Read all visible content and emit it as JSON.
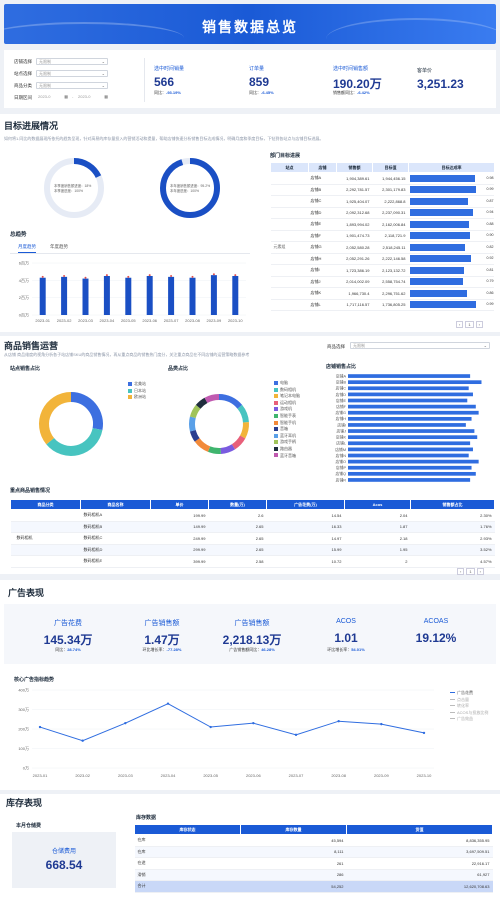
{
  "header": {
    "title": "销售数据总览"
  },
  "filters": [
    {
      "label": "店铺选择",
      "value": "无限制"
    },
    {
      "label": "站点选择",
      "value": "无限制"
    },
    {
      "label": "商品分类",
      "value": "无限制"
    },
    {
      "label": "日期区间",
      "start": "2023-0",
      "end": "2023-0"
    }
  ],
  "kpis": [
    {
      "label": "选中时间销量",
      "value": "566",
      "sub_label": "同比：",
      "sub_value": "-93.19%"
    },
    {
      "label": "订单量",
      "value": "859",
      "sub_label": "同比：",
      "sub_value": "-6.45%"
    },
    {
      "label": "选中时间销售额",
      "value": "190.20万",
      "sub_label": "销售额同比：",
      "sub_value": "-6.42%"
    },
    {
      "label": "客单价",
      "value": "3,251.23",
      "sub_label": "",
      "sub_value": ""
    }
  ],
  "target": {
    "title": "目标进展情况",
    "desc": "如何将1.同比的数据展现所依托的趋势呈现，针对高昂的库存量投入的营销活动和提量，帮助店铺快速分析销售目标达成情况，明确月度和季度目标，下钻到各站点与店铺目标进展。",
    "gauge1": {
      "line1": "本季度销售额进度：",
      "value1": "18%",
      "line2": "本季度进度：",
      "value2": "100%",
      "fraction": 0.18
    },
    "gauge2": {
      "line1": "本年度销售额进度：",
      "value1": "95.2%",
      "line2": "本年度进度：",
      "value2": "100%",
      "fraction": 0.952
    },
    "trend_title": "总趋势",
    "tabs": [
      "月度趋势",
      "年度趋势"
    ],
    "dept_title": "部门目标进展",
    "dept_headers": [
      "站点",
      "店铺",
      "销售额",
      "目标值",
      "目标达成率"
    ],
    "dept_group": "元素组",
    "dept_rows": [
      {
        "store": "店铺A",
        "sales": "1,904,389.61",
        "target": "1,944,456.15",
        "rate": 0.98
      },
      {
        "store": "店铺B",
        "sales": "2,292,781.57",
        "target": "2,301,179.83",
        "rate": 0.99
      },
      {
        "store": "店铺C",
        "sales": "1,925,404.07",
        "target": "2,222,868.8",
        "rate": 0.87
      },
      {
        "store": "店铺D",
        "sales": "2,092,312.68",
        "target": "2,237,090.31",
        "rate": 0.94
      },
      {
        "store": "店铺E",
        "sales": "1,893,994.02",
        "target": "2,162,006.84",
        "rate": 0.88
      },
      {
        "store": "店铺F",
        "sales": "1,901,474.73",
        "target": "2,118,721.9",
        "rate": 0.9
      },
      {
        "store": "店铺G",
        "sales": "2,052,580.28",
        "target": "2,518,245.11",
        "rate": 0.82
      },
      {
        "store": "店铺H",
        "sales": "2,052,291.26",
        "target": "2,222,146.58",
        "rate": 0.92
      },
      {
        "store": "店铺I",
        "sales": "1,723,386.19",
        "target": "2,123,132.72",
        "rate": 0.81
      },
      {
        "store": "店铺J",
        "sales": "2,014,002.09",
        "target": "2,558,754.74",
        "rate": 0.79
      },
      {
        "store": "店铺K",
        "sales": "1,966,730.4",
        "target": "2,296,751.62",
        "rate": 0.86
      },
      {
        "store": "店铺L",
        "sales": "1,717,116.57",
        "target": "1,736,805.25",
        "rate": 0.99
      }
    ],
    "dept_pager": "1"
  },
  "trend_chart": {
    "type": "bar",
    "categories": [
      "2023-01",
      "2023-02",
      "2023-03",
      "2023-04",
      "2023-05",
      "2023-06",
      "2023-07",
      "2023-08",
      "2023-09",
      "2023-10"
    ],
    "y_ticks": [
      "6百万",
      "4百万",
      "2百万",
      "0百万"
    ],
    "ylim": [
      0,
      6
    ],
    "values": [
      4.3,
      4.4,
      4.2,
      4.5,
      4.3,
      4.5,
      4.4,
      4.3,
      4.6,
      4.5
    ],
    "line_values": [
      4.4,
      4.5,
      4.3,
      4.6,
      4.4,
      4.6,
      4.5,
      4.4,
      4.7,
      4.6
    ]
  },
  "product": {
    "title": "商品销售运营",
    "desc": "从店铺 商品维度的视角分析各子站店铺SKU的商品销售情况，再从重点商品的销售热门度分，关注重点商品在不同店铺的运营策略数据参考",
    "site_select_label": "商品选择",
    "site_select_value": "无限制",
    "site_pie_title": "站点销售占比",
    "site_legend": [
      {
        "name": "北美站",
        "color": "#3d6fe0"
      },
      {
        "name": "日本站",
        "color": "#47c4c0"
      },
      {
        "name": "欧洲站",
        "color": "#f2b43a"
      }
    ],
    "site_pie": [
      {
        "value": 0.28,
        "color": "#3d6fe0"
      },
      {
        "value": 0.36,
        "color": "#47c4c0"
      },
      {
        "value": 0.36,
        "color": "#f2b43a"
      }
    ],
    "cat_pie_title": "品类占比",
    "cat_legend": [
      {
        "name": "电脑",
        "color": "#3d6fe0"
      },
      {
        "name": "数码相机",
        "color": "#47c4c0"
      },
      {
        "name": "笔记本电脑",
        "color": "#f2b43a"
      },
      {
        "name": "运动相机",
        "color": "#e8607a"
      },
      {
        "name": "游戏机",
        "color": "#7a5be0"
      },
      {
        "name": "智能手表",
        "color": "#3fb56e"
      },
      {
        "name": "智能手机",
        "color": "#f28a3a"
      },
      {
        "name": "音箱",
        "color": "#2a3e8f"
      },
      {
        "name": "蓝牙耳机",
        "color": "#5aa0e8"
      },
      {
        "name": "游戏手柄",
        "color": "#a0c45a"
      },
      {
        "name": "路由器",
        "color": "#1f2d3d"
      },
      {
        "name": "蓝牙音箱",
        "color": "#c05ab0"
      }
    ],
    "store_bar_title": "店铺销售占比",
    "store_bars": [
      {
        "name": "店铺A",
        "value": 0.86
      },
      {
        "name": "店铺B",
        "value": 0.94
      },
      {
        "name": "店铺C",
        "value": 0.85
      },
      {
        "name": "店铺D",
        "value": 0.88
      },
      {
        "name": "店铺E",
        "value": 0.84
      },
      {
        "name": "店铺F",
        "value": 0.9
      },
      {
        "name": "店铺G",
        "value": 0.92
      },
      {
        "name": "店铺H",
        "value": 0.87
      },
      {
        "name": "店铺I",
        "value": 0.83
      },
      {
        "name": "店铺J",
        "value": 0.89
      },
      {
        "name": "店铺K",
        "value": 0.91
      },
      {
        "name": "店铺L",
        "value": 0.86
      },
      {
        "name": "店铺M",
        "value": 0.88
      },
      {
        "name": "店铺N",
        "value": 0.85
      },
      {
        "name": "店铺O",
        "value": 0.92
      },
      {
        "name": "店铺P",
        "value": 0.87
      },
      {
        "name": "店铺Q",
        "value": 0.9
      },
      {
        "name": "店铺R",
        "value": 0.86
      }
    ],
    "key_title": "重点商品销售情况",
    "key_headers": [
      "商品分类",
      "商品名称",
      "单价",
      "数量(万)",
      "广告花费(万)",
      "Acos",
      "销售额占比"
    ],
    "key_group": "数码相机",
    "key_rows": [
      {
        "name": "数码相机A",
        "price": "199.99",
        "qty": "2.6",
        "cost": "14.54",
        "acos": "2.04",
        "share": "2.30%"
      },
      {
        "name": "数码相机B",
        "price": "149.99",
        "qty": "2.65",
        "cost": "16.33",
        "acos": "1.87",
        "share": "1.76%"
      },
      {
        "name": "数码相机C",
        "price": "249.99",
        "qty": "2.65",
        "cost": "14.97",
        "acos": "2.18",
        "share": "2.93%"
      },
      {
        "name": "数码相机D",
        "price": "299.99",
        "qty": "2.65",
        "cost": "15.99",
        "acos": "1.95",
        "share": "3.52%"
      },
      {
        "name": "数码相机E",
        "price": "399.99",
        "qty": "2.58",
        "cost": "10.72",
        "acos": "2",
        "share": "4.57%"
      }
    ],
    "key_pager": "1"
  },
  "ads": {
    "title": "广告表现",
    "kpis": [
      {
        "label": "广告花费",
        "value": "145.34万",
        "sub_label": "同比：",
        "sub_value": "28.74%"
      },
      {
        "label": "广告销售额",
        "value": "1.47万",
        "sub_label": "环比增长率：",
        "sub_value": "-77.28%"
      },
      {
        "label": "广告销售额",
        "value": "2,218.13万",
        "sub_label": "广告销售额同比：",
        "sub_value": "46.28%"
      },
      {
        "label": "ACOS",
        "value": "1.01",
        "sub_label": "环比增长率：",
        "sub_value": "54.01%"
      },
      {
        "label": "ACOAS",
        "value": "19.12%",
        "sub_label": "",
        "sub_value": ""
      }
    ],
    "chart_title": "核心广告指标趋势",
    "legend": [
      "广告花费",
      "点击量",
      "转化率",
      "ACOS与投放比例",
      "广告效益"
    ]
  },
  "ad_chart": {
    "type": "line",
    "x": [
      "2023-01",
      "2023-02",
      "2023-03",
      "2023-04",
      "2023-05",
      "2023-06",
      "2023-07",
      "2023-08",
      "2023-09",
      "2023-10"
    ],
    "y_ticks": [
      "400万",
      "300万",
      "200万",
      "100万",
      "0万"
    ],
    "ylim": [
      0,
      400
    ],
    "values": [
      210,
      140,
      230,
      330,
      210,
      230,
      170,
      240,
      225,
      180
    ]
  },
  "inventory": {
    "title": "库存表现",
    "month_title": "本月仓储费",
    "fee_label": "仓储费用",
    "fee_value": "668.54",
    "table_title": "库存数据",
    "headers": [
      "库存状态",
      "库存数量",
      "货值"
    ],
    "rows": [
      {
        "status": "在库",
        "qty": "45,594",
        "value": "8,836,355.95"
      },
      {
        "status": "在库",
        "qty": "8,111",
        "value": "3,697,509.51"
      },
      {
        "status": "在途",
        "qty": "261",
        "value": "22,916.17"
      },
      {
        "status": "滞销",
        "qty": "286",
        "value": "61,927"
      },
      {
        "status": "合计",
        "qty": "54,252",
        "value": "12,620,708.63"
      }
    ]
  }
}
